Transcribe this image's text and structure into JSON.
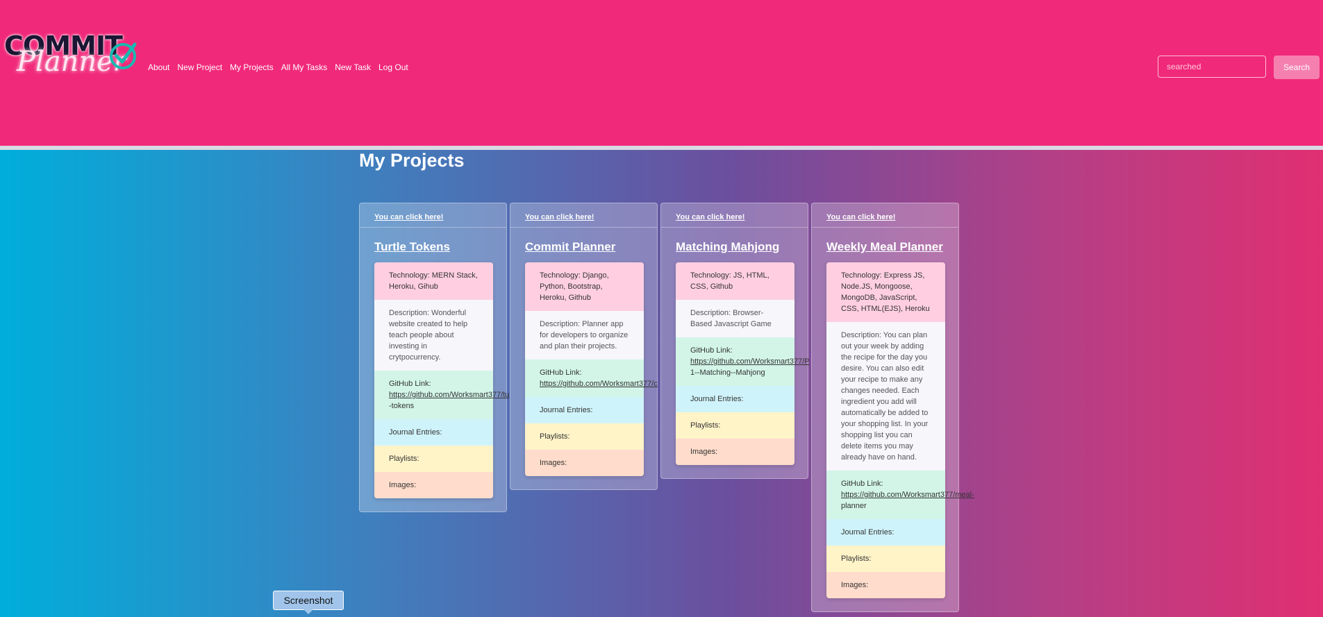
{
  "header": {
    "logo_top": "COMMIT",
    "logo_bottom": "Planner",
    "nav": [
      "About",
      "New Project",
      "My Projects",
      "All My Tasks",
      "New Task",
      "Log Out"
    ],
    "search_placeholder": "searched",
    "search_button": "Search"
  },
  "page_title": "My Projects",
  "click_here": "You can click here!",
  "projects": [
    {
      "title": "Turtle Tokens",
      "technology": "Technology: MERN Stack, Heroku, Gihub",
      "description": "Description: Wonderful website created to help teach people about investing in crytpocurrency.",
      "github_label": "GitHub Link:",
      "github_line1": "https://github.com/Worksmart377/tu",
      "github_line2": "-tokens",
      "journal": "Journal Entries:",
      "playlists": "Playlists:",
      "images": "Images:"
    },
    {
      "title": "Commit Planner",
      "technology": "Technology: Django, Python, Bootstrap, Heroku, Github",
      "description": "Description: Planner app for developers to organize and plan their projects.",
      "github_label": "GitHub Link:",
      "github_line1": "https://github.com/Worksmart377/c",
      "github_line2": "",
      "journal": "Journal Entries:",
      "playlists": "Playlists:",
      "images": "Images:"
    },
    {
      "title": "Matching Mahjong",
      "technology": "Technology: JS, HTML, CSS, Github",
      "description": "Description: Browser-Based Javascript Game",
      "github_label": "GitHub Link:",
      "github_line1": "https://github.com/Worksmart377/P",
      "github_line2": "1--Matching--Mahjong",
      "journal": "Journal Entries:",
      "playlists": "Playlists:",
      "images": "Images:"
    },
    {
      "title": "Weekly Meal Planner",
      "technology": "Technology: Express JS, Node.JS, Mongoose, MongoDB, JavaScript, CSS, HTML(EJS), Heroku",
      "description": "Description: You can plan out your week by adding the recipe for the day you desire. You can also edit your recipe to make any changes needed. Each ingredient you add will automatically be added to your shopping list. In your shopping list you can delete items you may already have on hand.",
      "github_label": "GitHub Link:",
      "github_line1": "https://github.com/Worksmart377/meal-",
      "github_line2": "planner",
      "journal": "Journal Entries:",
      "playlists": "Playlists:",
      "images": "Images:"
    }
  ],
  "tooltip": "Screenshot"
}
